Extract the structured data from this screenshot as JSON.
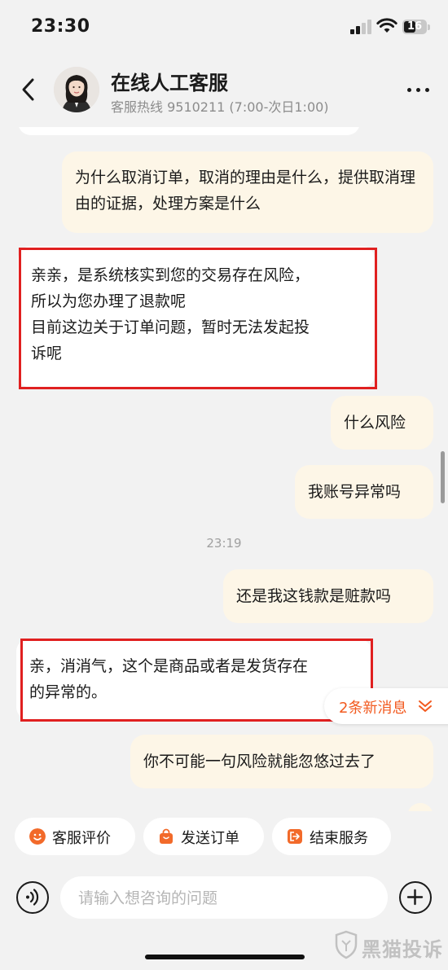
{
  "status_bar": {
    "time": "23:30",
    "battery": "16"
  },
  "header": {
    "title": "在线人工客服",
    "subtitle": "客服热线 9510211 (7:00-次日1:00)"
  },
  "messages": [
    {
      "from": "user",
      "text": "为什么取消订单，取消的理由是什么，提供取消理由的证据，处理方案是什么"
    },
    {
      "from": "agent",
      "lines": [
        "亲亲，是系统核实到您的交易存在风险，",
        "所以为您办理了退款呢",
        "目前这边关于订单问题，暂时无法发起投",
        "诉呢"
      ]
    },
    {
      "from": "user",
      "text": "什么风险"
    },
    {
      "from": "user",
      "text": "我账号异常吗"
    },
    {
      "from": "user",
      "text": "还是我这钱款是赃款吗"
    },
    {
      "from": "agent",
      "lines": [
        "亲，消消气，这个是商品或者是发货存在",
        "的异常的。"
      ]
    },
    {
      "from": "user",
      "text": "你不可能一句风险就能忽悠过去了"
    }
  ],
  "time_separator": "23:19",
  "new_messages_label": "2条新消息",
  "quick_actions": [
    {
      "label": "客服评价",
      "icon": "smile-icon"
    },
    {
      "label": "发送订单",
      "icon": "shopping-bag-icon"
    },
    {
      "label": "结束服务",
      "icon": "exit-icon"
    }
  ],
  "input": {
    "placeholder": "请输入想咨询的问题",
    "value": ""
  },
  "watermark": "黑猫投诉",
  "colors": {
    "accent": "#f25a1f",
    "user_bubble": "#fdf6e7",
    "highlight_box": "#e02020",
    "background": "#f2f2f2"
  }
}
